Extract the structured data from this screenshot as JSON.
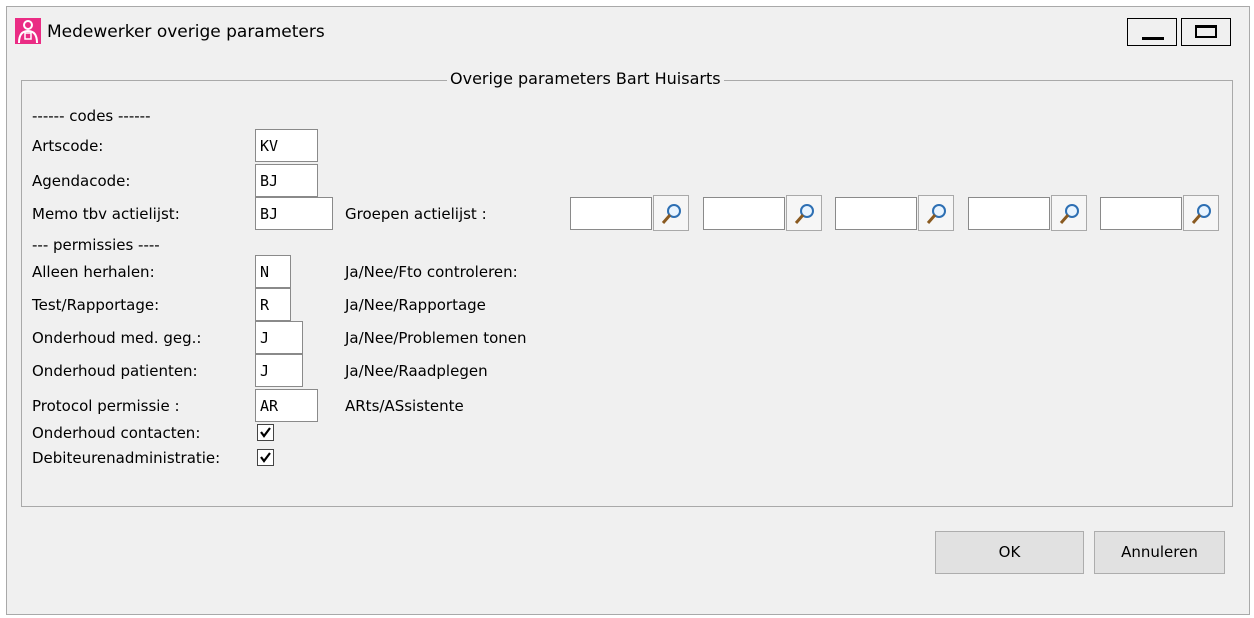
{
  "window": {
    "title": "Medewerker overige parameters"
  },
  "group": {
    "title": "Overige parameters Bart Huisarts"
  },
  "codes": {
    "header": "------ codes ------",
    "artscode": {
      "label": "Artscode:",
      "value": "KV"
    },
    "agendacode": {
      "label": "Agendacode:",
      "value": "BJ"
    },
    "memo": {
      "label": "Memo tbv actielijst:",
      "value": "BJ"
    },
    "groepen": {
      "label": "Groepen actielijst :",
      "values": [
        "",
        "",
        "",
        "",
        ""
      ]
    }
  },
  "permissions": {
    "header": "--- permissies ----",
    "alleen_herhalen": {
      "label": "Alleen herhalen:",
      "value": "N",
      "hint": "Ja/Nee/Fto controleren:"
    },
    "test_rapportage": {
      "label": "Test/Rapportage:",
      "value": "R",
      "hint": "Ja/Nee/Rapportage"
    },
    "onderhoud_med": {
      "label": "Onderhoud med. geg.:",
      "value": "J",
      "hint": "Ja/Nee/Problemen tonen"
    },
    "onderhoud_patienten": {
      "label": "Onderhoud patienten:",
      "value": "J",
      "hint": "Ja/Nee/Raadplegen"
    },
    "protocol": {
      "label": "Protocol permissie :",
      "value": "AR",
      "hint": "ARts/ASsistente"
    },
    "onderhoud_contacten": {
      "label": "Onderhoud contacten:",
      "checked": true
    },
    "debiteuren": {
      "label": "Debiteurenadministratie:",
      "checked": true
    }
  },
  "buttons": {
    "ok": "OK",
    "cancel": "Annuleren"
  },
  "colors": {
    "app_icon": "#ea2c84",
    "face": "#f0f0f0",
    "border": "#a9a9a9"
  },
  "icons": {
    "app": "user-icon",
    "lookup": "magnifier-icon",
    "check": "checkmark-icon"
  }
}
